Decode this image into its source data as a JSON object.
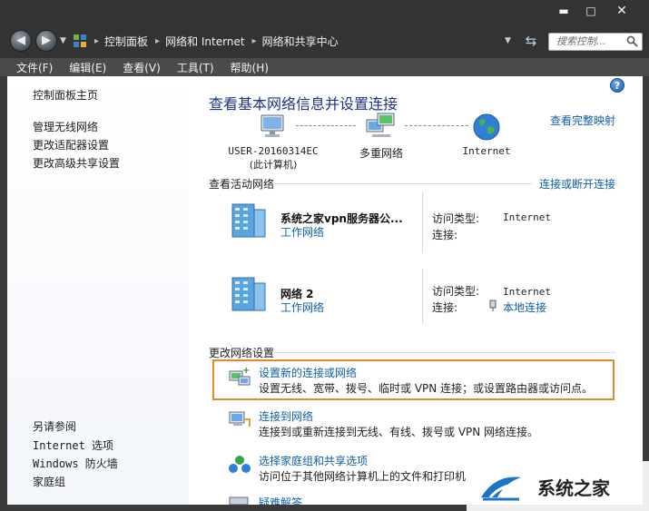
{
  "window": {
    "minimize": "▬",
    "maximize": "□",
    "close": "✕"
  },
  "address": {
    "crumbs": [
      "控制面板",
      "网络和 Internet",
      "网络和共享中心"
    ],
    "search_placeholder": "搜索控制...",
    "icons": {
      "back": "back-arrow-icon",
      "forward": "forward-arrow-icon",
      "refresh": "refresh-icon",
      "search": "search-icon"
    }
  },
  "menu": [
    "文件(F)",
    "编辑(E)",
    "查看(V)",
    "工具(T)",
    "帮助(H)"
  ],
  "sidebar": {
    "top_links": [
      "控制面板主页",
      "管理无线网络",
      "更改适配器设置",
      "更改高级共享设置"
    ],
    "see_also_title": "另请参阅",
    "see_also": [
      "Internet 选项",
      "Windows 防火墙",
      "家庭组"
    ]
  },
  "main": {
    "help": "?",
    "heading": "查看基本网络信息并设置连接",
    "full_map_link": "查看完整映射",
    "map": {
      "computer_name": "USER-20160314EC",
      "computer_sub": "(此计算机)",
      "middle": "多重网络",
      "internet": "Internet"
    },
    "active_title": "查看活动网络",
    "connect_link": "连接或断开连接",
    "networks": [
      {
        "name": "系统之家vpn服务器公...",
        "type": "工作网络",
        "access_label": "访问类型:",
        "access_value": "Internet",
        "conn_label": "连接:",
        "conn_value": ""
      },
      {
        "name": "网络  2",
        "type": "工作网络",
        "access_label": "访问类型:",
        "access_value": "Internet",
        "conn_label": "连接:",
        "conn_value": "本地连接"
      }
    ],
    "change_title": "更改网络设置",
    "tasks": [
      {
        "title": "设置新的连接或网络",
        "desc": "设置无线、宽带、拨号、临时或 VPN 连接；或设置路由器或访问点。"
      },
      {
        "title": "连接到网络",
        "desc": "连接到或重新连接到无线、有线、拨号或 VPN 网络连接。"
      },
      {
        "title": "选择家庭组和共享选项",
        "desc": "访问位于其他网络计算机上的文件和打印机"
      },
      {
        "title": "疑难解答",
        "desc": ""
      }
    ]
  },
  "watermark": {
    "text": "系统之家"
  },
  "colors": {
    "link": "#0f5ea8",
    "heading": "#1e3287",
    "highlight": "#e08a2a",
    "chrome": "#333333"
  }
}
